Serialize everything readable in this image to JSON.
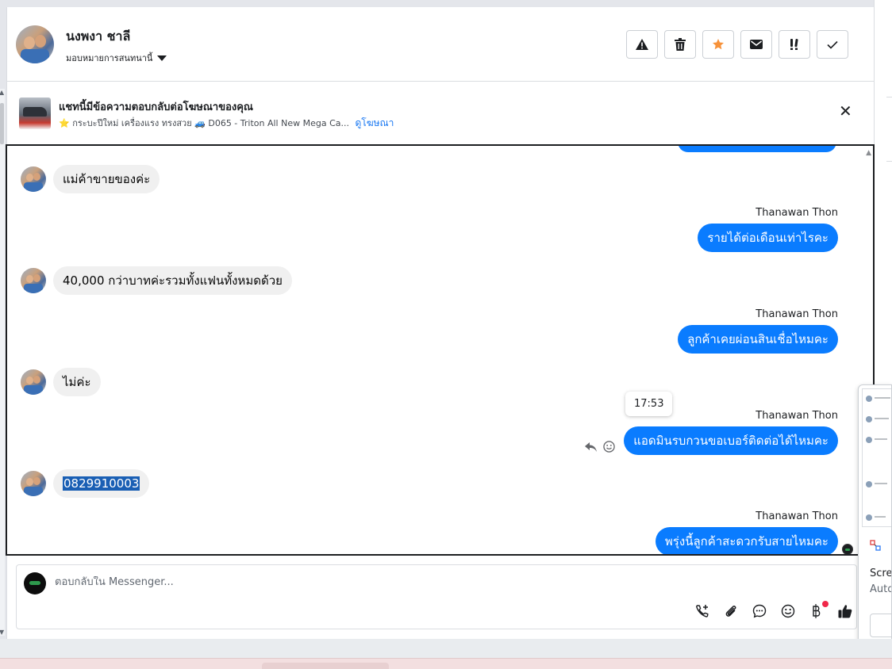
{
  "header": {
    "contact_name": "นงพงา ชาลี",
    "assign_label": "มอบหมายการสนทนานี้",
    "actions": [
      {
        "name": "spam-icon",
        "glyph": "!"
      },
      {
        "name": "trash-icon",
        "glyph": "trash"
      },
      {
        "name": "star-icon",
        "glyph": "★",
        "color": "#f7923a"
      },
      {
        "name": "mail-icon",
        "glyph": "mail"
      },
      {
        "name": "priority-icon",
        "glyph": "!!"
      },
      {
        "name": "check-icon",
        "glyph": "✓"
      }
    ]
  },
  "banner": {
    "title": "แชทนี้มีข้อความตอบกลับต่อโฆษณาของคุณ",
    "star": "⭐",
    "description": "กระบะปีใหม่ เครื่องแรง ทรงสวย 🚙 D065 - Triton All New Mega Ca...",
    "link": "ดูโฆษณา",
    "close": "✕"
  },
  "messages": [
    {
      "type": "in",
      "text": "แม่ค้าขายของค่ะ"
    },
    {
      "type": "out",
      "sender": "Thanawan Thon",
      "text": "รายได้ต่อเดือนเท่าไรคะ"
    },
    {
      "type": "in",
      "text": "40,000 กว่าบาทค่ะรวมทั้งแฟนทั้งหมดด้วย"
    },
    {
      "type": "out",
      "sender": "Thanawan Thon",
      "text": "ลูกค้าเคยผ่อนสินเชื่อไหมคะ"
    },
    {
      "type": "in",
      "text": "ไม่ค่ะ"
    },
    {
      "type": "out",
      "sender": "Thanawan Thon",
      "text": "แอดมินรบกวนขอเบอร์ติดต่อได้ไหมคะ"
    },
    {
      "type": "in",
      "text": "0829910003",
      "selected": true
    },
    {
      "type": "out",
      "sender": "Thanawan Thon",
      "text": "พรุ่งนี้ลูกค้าสะดวกรับสายไหมคะ"
    }
  ],
  "tooltip_time": "17:53",
  "composer": {
    "placeholder": "ตอบกลับใน Messenger...",
    "tools": [
      "call-add-icon",
      "attachment-icon",
      "chat-bubble-icon",
      "emoji-icon",
      "baht-icon",
      "like-icon"
    ],
    "notification_color": "#f02849"
  },
  "overlay": {
    "line1": "Scree",
    "line2": "Auto"
  },
  "colors": {
    "outgoing_bubble": "#0a7cff",
    "incoming_bubble": "#f0f0f0",
    "link": "#1877f2"
  }
}
